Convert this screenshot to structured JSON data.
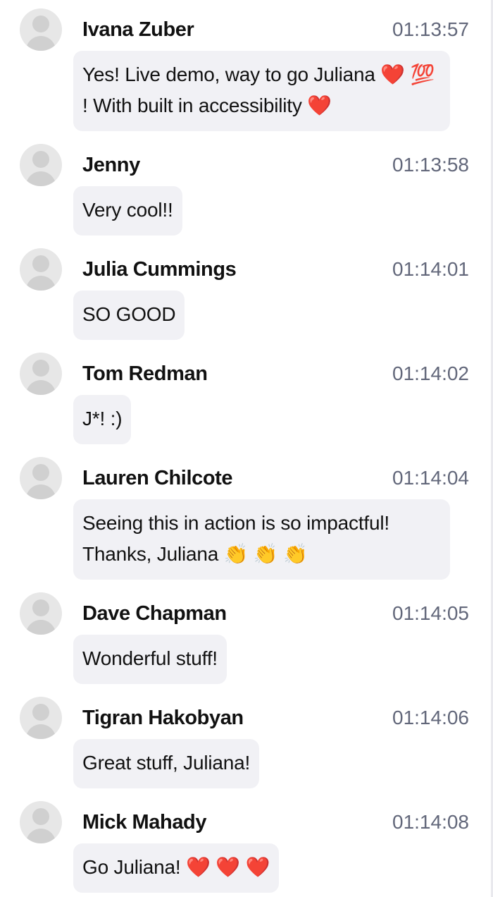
{
  "messages": [
    {
      "author": "Ivana Zuber",
      "time": "01:13:57",
      "text": "Yes! Live demo, way to go Juliana ❤️ 💯 ! With built in accessibility ❤️"
    },
    {
      "author": "Jenny",
      "time": "01:13:58",
      "text": "Very cool!!"
    },
    {
      "author": "Julia Cummings",
      "time": "01:14:01",
      "text": "SO GOOD"
    },
    {
      "author": "Tom Redman",
      "time": "01:14:02",
      "text": "J*! :)"
    },
    {
      "author": "Lauren Chilcote",
      "time": "01:14:04",
      "text": "Seeing this in action is so impactful! Thanks, Juliana 👏 👏 👏"
    },
    {
      "author": "Dave Chapman",
      "time": "01:14:05",
      "text": "Wonderful stuff!"
    },
    {
      "author": "Tigran Hakobyan",
      "time": "01:14:06",
      "text": "Great stuff, Juliana!"
    },
    {
      "author": "Mick Mahady",
      "time": "01:14:08",
      "text": "Go Juliana! ❤️ ❤️ ❤️"
    }
  ]
}
